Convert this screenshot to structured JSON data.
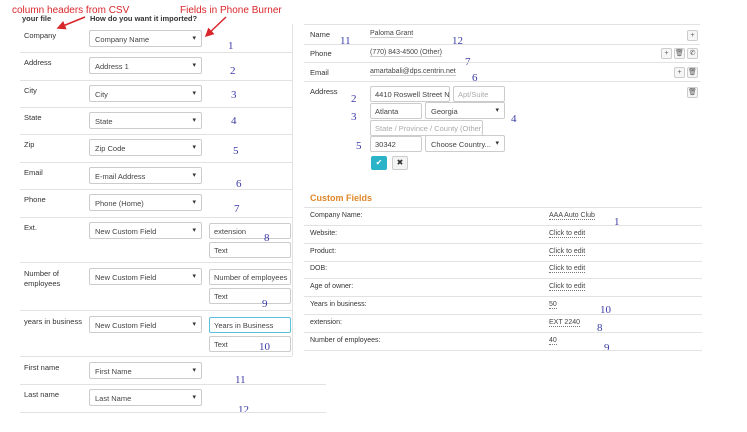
{
  "annotations": {
    "csv_headers": "column headers from CSV",
    "phoneburner_fields": "Fields in Phone Burner"
  },
  "left": {
    "header_file": "your file",
    "header_import": "How do you want it imported?",
    "rows": [
      {
        "label": "Company",
        "select": "Company Name",
        "num": "1"
      },
      {
        "label": "Address",
        "select": "Address 1",
        "num": "2"
      },
      {
        "label": "City",
        "select": "City",
        "num": "3"
      },
      {
        "label": "State",
        "select": "State",
        "num": "4"
      },
      {
        "label": "Zip",
        "select": "Zip Code",
        "num": "5"
      },
      {
        "label": "Email",
        "select": "E-mail Address",
        "num": "6"
      },
      {
        "label": "Phone",
        "select": "Phone (Home)",
        "num": "7"
      },
      {
        "label": "Ext.",
        "select": "New Custom Field",
        "input1": "extension",
        "input2": "Text",
        "num": "8"
      },
      {
        "label": "Number of employees",
        "select": "New Custom Field",
        "input1": "Number of employees",
        "input2": "Text",
        "num": "9"
      },
      {
        "label": "years in business",
        "select": "New Custom Field",
        "input1": "Years in Business",
        "input2": "Text",
        "num": "10"
      },
      {
        "label": "First name",
        "select": "First Name",
        "num": "11"
      },
      {
        "label": "Last name",
        "select": "Last Name",
        "num": "12"
      }
    ]
  },
  "contact": {
    "name_label": "Name",
    "name_value": "Paloma Grant",
    "phone_label": "Phone",
    "phone_value": "(770) 843-4500 (Other)",
    "email_label": "Email",
    "email_value": "amartabali@dps.centrin.net",
    "address_label": "Address",
    "street": "4410 Roswell Street NE",
    "apt_placeholder": "Apt/Suite",
    "city": "Atlanta",
    "state": "Georgia",
    "province_placeholder": "State / Province / County (Other)",
    "zip": "30342",
    "country": "Choose Country...",
    "nums": {
      "name": "11",
      "name_value": "12",
      "phone": "7",
      "email": "6",
      "street": "2",
      "city": "3",
      "state": "4",
      "zip": "5"
    }
  },
  "custom_fields": {
    "title": "Custom Fields",
    "rows": [
      {
        "label": "Company Name:",
        "value": "AAA Auto Club",
        "num": "1"
      },
      {
        "label": "Website:",
        "value": "Click to edit",
        "num": ""
      },
      {
        "label": "Product:",
        "value": "Click to edit",
        "num": ""
      },
      {
        "label": "DOB:",
        "value": "Click to edit",
        "num": ""
      },
      {
        "label": "Age of owner:",
        "value": "Click to edit",
        "num": ""
      },
      {
        "label": "Years in business:",
        "value": "50",
        "num": "10"
      },
      {
        "label": "extension:",
        "value": "EXT 2240",
        "num": "8"
      },
      {
        "label": "Number of employees:",
        "value": "40",
        "num": "9"
      }
    ]
  },
  "icons": {
    "caret": "▾",
    "plus": "+",
    "trash": "🗑",
    "phone": "✆",
    "check": "✔",
    "close": "✖"
  },
  "colors": {
    "annotation": "#d9262a",
    "number": "#3a3aa8",
    "accent": "#2bb3c8",
    "custom_title": "#e0872a"
  }
}
